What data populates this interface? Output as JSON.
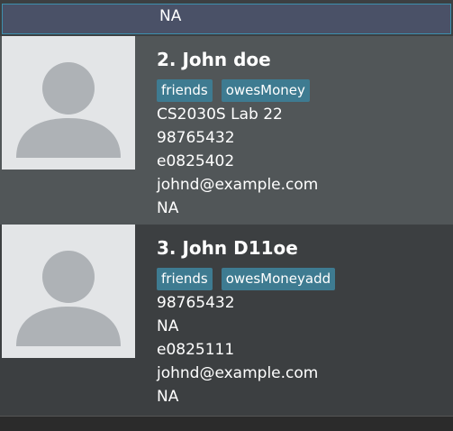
{
  "selected_strip": {
    "last_line": "NA"
  },
  "people": [
    {
      "index_name": "2.  John doe",
      "tags": [
        "friends",
        "owesMoney"
      ],
      "fields": [
        "CS2030S Lab 22",
        "98765432",
        "e0825402",
        "johnd@example.com",
        "NA"
      ]
    },
    {
      "index_name": "3.  John D11oe",
      "tags": [
        "friends",
        "owesMoneyadd"
      ],
      "fields": [
        "98765432",
        "NA",
        "e0825111",
        "johnd@example.com",
        "NA"
      ]
    }
  ],
  "icons": {
    "avatar": "person-avatar-icon"
  },
  "colors": {
    "selected_bg": "#4a5167",
    "selected_border": "#3d8fae",
    "card_alt_bg": "#515658",
    "list_bg": "#3c3f41",
    "tag_bg": "#3e7b91",
    "avatar_bg": "#e3e5e7",
    "avatar_fg": "#aeb2b6"
  }
}
